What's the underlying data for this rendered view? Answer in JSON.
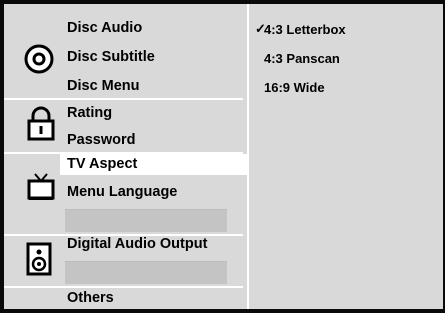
{
  "menu": {
    "groups": [
      {
        "icon": "disc-icon",
        "items": [
          "Disc Audio",
          "Disc Subtitle",
          "Disc Menu"
        ]
      },
      {
        "icon": "padlock-icon",
        "items": [
          "Rating",
          "Password"
        ]
      },
      {
        "icon": "tv-icon",
        "items": [
          "TV Aspect",
          "Menu Language"
        ]
      },
      {
        "icon": "speaker-icon",
        "items": [
          "Digital Audio Output"
        ]
      },
      {
        "icon": "none",
        "items": [
          "Others"
        ]
      }
    ],
    "selected_item": "TV Aspect"
  },
  "options": {
    "items": [
      "4:3 Letterbox",
      "4:3 Panscan",
      "16:9 Wide"
    ],
    "selected": "4:3 Letterbox",
    "check_mark": "✓"
  },
  "colors": {
    "background": "#d9d9d9",
    "border": "#0a0a0a",
    "highlight": "#ffffff",
    "empty_slot": "#c4c4c4"
  }
}
